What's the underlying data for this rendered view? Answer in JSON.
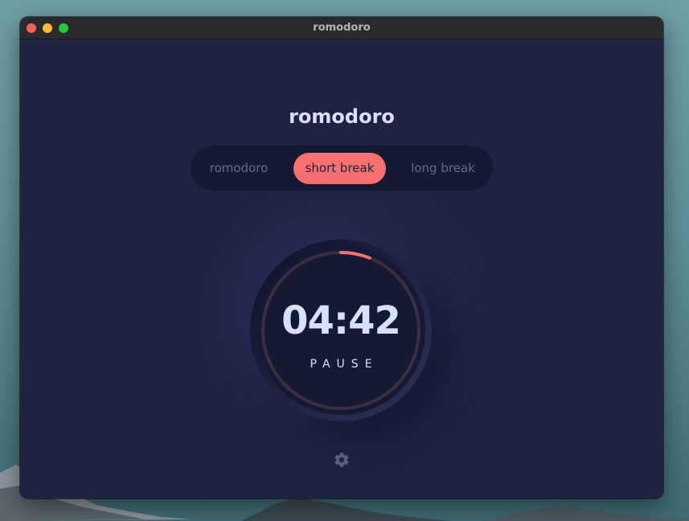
{
  "window": {
    "title": "romodoro"
  },
  "app": {
    "title": "romodoro"
  },
  "tabs": [
    {
      "label": "romodoro",
      "active": false
    },
    {
      "label": "short break",
      "active": true
    },
    {
      "label": "long break",
      "active": false
    }
  ],
  "timer": {
    "time": "04:42",
    "action_label": "PAUSE",
    "progress": 0.06
  },
  "icons": {
    "settings": "gear-icon"
  },
  "colors": {
    "background": "#1f2240",
    "accent": "#f87070",
    "text": "#d7e0fd",
    "inactive_tab_text": "#656a8a"
  }
}
